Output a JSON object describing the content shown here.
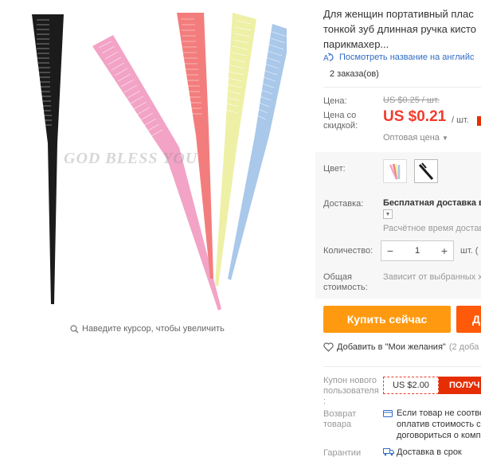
{
  "product": {
    "title_lines": [
      "Для женщин портативный плас",
      "тонкой зуб длинная ручка кисто",
      "парикмахер..."
    ],
    "translate_link": "Посмотреть название на английс",
    "orders": "2 заказа(ов)",
    "watermark": "GOD BLESS YOU"
  },
  "gallery": {
    "zoom_hint": "Наведите курсор, чтобы увеличить",
    "comb_colors": [
      "#1b1b1b",
      "#f2a3c6",
      "#f37d7d",
      "#eef0a6",
      "#a9c8ea"
    ]
  },
  "price": {
    "label": "Цена:",
    "old": "US $0.25 / шт.",
    "discount_label_1": "Цена со",
    "discount_label_2": "скидкой:",
    "new": "US $0.21",
    "unit": "/ шт.",
    "wholesale": "Оптовая цена"
  },
  "sku": {
    "color_label": "Цвет:",
    "shipping_label": "Доставка:",
    "shipping_value": "Бесплатная доставка в",
    "delivery_time": "Расчётное время доставк",
    "quantity_label": "Количество:",
    "quantity_value": "1",
    "quantity_unit": "шт. (",
    "total_label_1": "Общая",
    "total_label_2": "стоимость:",
    "total_value": "Зависит от выбранных х"
  },
  "actions": {
    "buy_now": "Купить сейчас",
    "add_to_cart": "Д",
    "wishlist": "Добавить в \"Мои желания\"",
    "wishlist_count": "(2 доба"
  },
  "coupon": {
    "label_1": "Купон нового",
    "label_2": "пользователя",
    "label_3": ":",
    "code": "US $2.00",
    "get": "ПОЛУЧ"
  },
  "returns": {
    "label_1": "Возврат",
    "label_2": "товара",
    "text_1": "Если товар не соотве",
    "text_2": "оплатив стоимость с",
    "text_3": "договориться о комп"
  },
  "guarantee": {
    "label": "Гарантии",
    "text": "Доставка в срок"
  },
  "colors": {
    "accent_price": "#f03c2c",
    "buy_now": "#ff9a10",
    "add_cart": "#ff5a0a",
    "link": "#2f6cc3"
  }
}
